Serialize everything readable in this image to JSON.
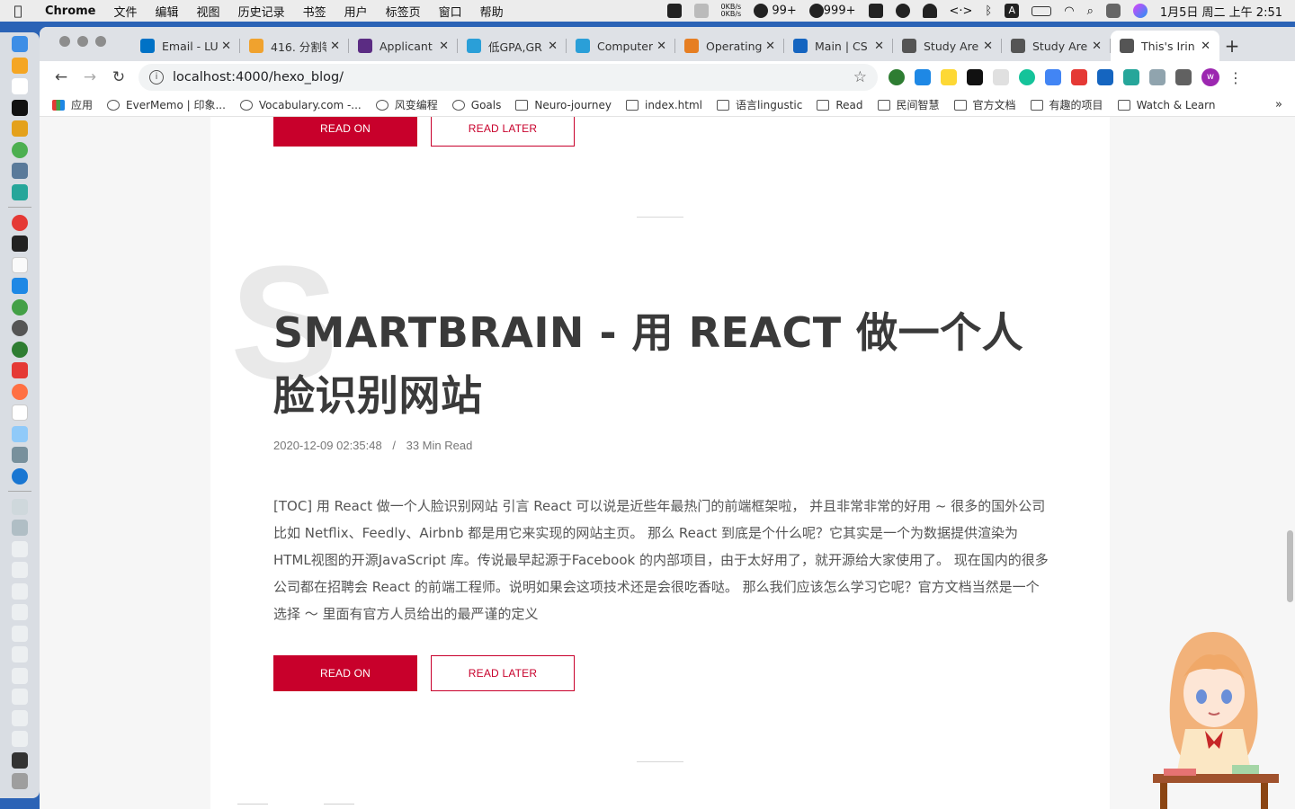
{
  "menubar": {
    "apple": "",
    "app_name": "Chrome",
    "menus": [
      "文件",
      "编辑",
      "视图",
      "历史记录",
      "书签",
      "用户",
      "标签页",
      "窗口",
      "帮助"
    ],
    "net_up": "0KB/s",
    "net_down": "0KB/s",
    "wechat_badge": "99+",
    "mail_badge": "999+",
    "clock": "1月5日 周二 上午 2:51"
  },
  "tabs": [
    {
      "title": "Email - LU",
      "color": "#0072c6"
    },
    {
      "title": "416. 分割等",
      "color": "#f0a22e"
    },
    {
      "title": "Applicant",
      "color": "#5b2c83"
    },
    {
      "title": "低GPA,GR",
      "color": "#2a9fd8"
    },
    {
      "title": "Computer",
      "color": "#2a9fd8"
    },
    {
      "title": "Operating",
      "color": "#e67e22"
    },
    {
      "title": "Main | CS",
      "color": "#1565c0"
    },
    {
      "title": "Study Are",
      "color": "#555555"
    },
    {
      "title": "Study Are",
      "color": "#555555"
    },
    {
      "title": "This's Irin",
      "color": "#555555"
    }
  ],
  "tab_close": "✕",
  "new_tab": "+",
  "address": {
    "url": "localhost:4000/hexo_blog/"
  },
  "profile_initial": "w",
  "bookmarks": [
    {
      "label": "应用",
      "kind": "app"
    },
    {
      "label": "EverMemo | 印象...",
      "kind": "round"
    },
    {
      "label": "Vocabulary.com -...",
      "kind": "round"
    },
    {
      "label": "风变编程",
      "kind": "round"
    },
    {
      "label": "Goals",
      "kind": "round"
    },
    {
      "label": "Neuro-journey",
      "kind": "folder"
    },
    {
      "label": "index.html",
      "kind": "folder"
    },
    {
      "label": "语言lingustic",
      "kind": "folder"
    },
    {
      "label": "Read",
      "kind": "folder"
    },
    {
      "label": "民间智慧",
      "kind": "folder"
    },
    {
      "label": "官方文档",
      "kind": "folder"
    },
    {
      "label": "有趣的项目",
      "kind": "folder"
    },
    {
      "label": "Watch & Learn",
      "kind": "folder"
    }
  ],
  "bookmarks_more": "»",
  "post_prev": {
    "read_on": "READ ON",
    "read_later": "READ LATER"
  },
  "post": {
    "initial": "S",
    "title": "SMARTBRAIN - 用 REACT 做一个人脸识别网站",
    "date": "2020-12-09 02:35:48",
    "meta_sep": "/",
    "read_time": "33 Min Read",
    "excerpt": "[TOC] 用 React 做一个人脸识别网站 引言 React 可以说是近些年最热门的前端框架啦， 并且非常非常的好用 ~ 很多的国外公司比如 Netflix、Feedly、Airbnb 都是用它来实现的网站主页。 那么 React 到底是个什么呢？它其实是一个为数据提供渲染为HTML视图的开源JavaScript 库。传说最早起源于Facebook 的内部项目，由于太好用了，就开源给大家使用了。 现在国内的很多公司都在招聘会 React 的前端工程师。说明如果会这项技术还是会很吃香哒。 那么我们应该怎么学习它呢？官方文档当然是一个选择 ～ 里面有官方人员给出的最严谨的定义",
    "read_on": "READ ON",
    "read_later": "READ LATER"
  },
  "colors": {
    "accent": "#c8002b",
    "title": "#3a3a3a",
    "text": "#555555"
  }
}
